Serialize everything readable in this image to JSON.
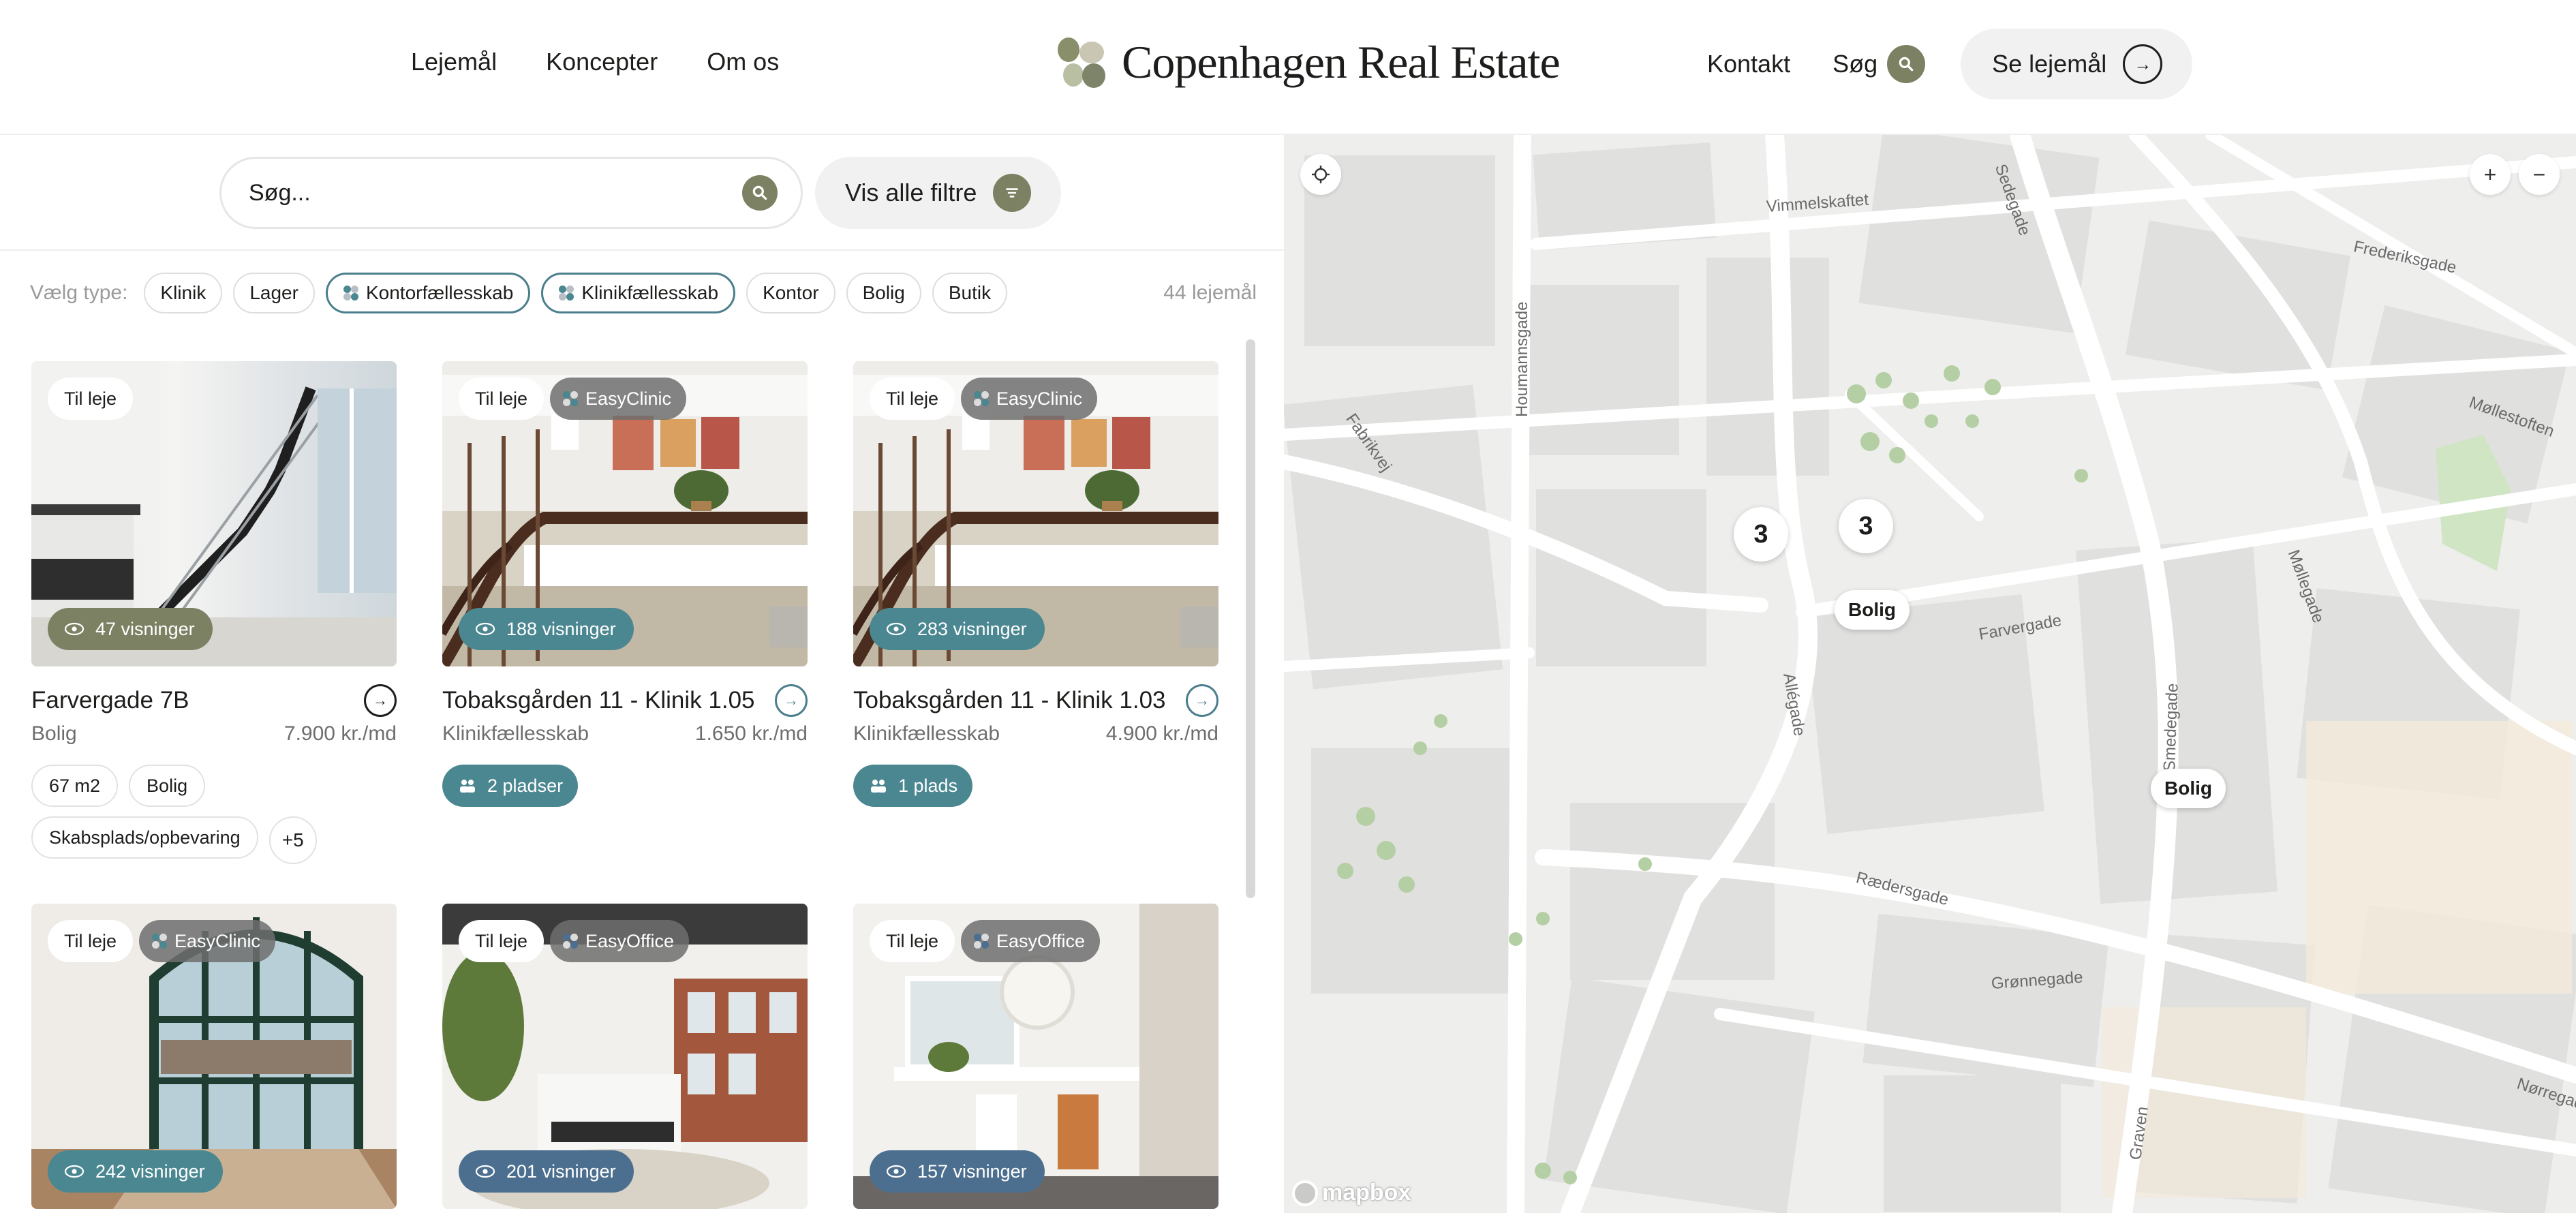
{
  "header": {
    "nav_left": [
      "Lejemål",
      "Koncepter",
      "Om os"
    ],
    "logo_text": "Copenhagen Real Estate",
    "contact": "Kontakt",
    "search": "Søg",
    "cta": "Se lejemål"
  },
  "search": {
    "placeholder": "Søg...",
    "filters_label": "Vis alle filtre"
  },
  "types": {
    "label": "Vælg type:",
    "chips": [
      "Klinik",
      "Lager",
      "Kontorfællesskab",
      "Klinikfællesskab",
      "Kontor",
      "Bolig",
      "Butik"
    ],
    "count": "44 lejemål"
  },
  "listings": [
    {
      "status": "Til leje",
      "brand": "",
      "views": "47 visninger",
      "title": "Farvergade 7B",
      "type": "Bolig",
      "price": "7.900 kr./md",
      "tags": [
        "67 m2",
        "Bolig",
        "Skabsplads/opbevaring",
        "+5"
      ],
      "seats": ""
    },
    {
      "status": "Til leje",
      "brand": "EasyClinic",
      "views": "188 visninger",
      "title": "Tobaksgården 11 - Klinik 1.05",
      "type": "Klinikfællesskab",
      "price": "1.650 kr./md",
      "tags": [],
      "seats": "2 pladser"
    },
    {
      "status": "Til leje",
      "brand": "EasyClinic",
      "views": "283 visninger",
      "title": "Tobaksgården 11 - Klinik 1.03",
      "type": "Klinikfællesskab",
      "price": "4.900 kr./md",
      "tags": [],
      "seats": "1 plads"
    },
    {
      "status": "Til leje",
      "brand": "EasyClinic",
      "views": "242 visninger"
    },
    {
      "status": "Til leje",
      "brand": "EasyOffice",
      "views": "201 visninger"
    },
    {
      "status": "Til leje",
      "brand": "EasyOffice",
      "views": "157 visninger"
    }
  ],
  "map": {
    "clusters": [
      "3",
      "3"
    ],
    "markers": [
      "Bolig",
      "Bolig"
    ],
    "streets": [
      "Vimmelskaftet",
      "Frederiksgade",
      "Houmannsgade",
      "Fabrikvej",
      "Møllestoften",
      "Møllegade",
      "Farvergade",
      "Allégade",
      "Smedegade",
      "Rædersgade",
      "Grønnegade",
      "Graven",
      "Nørregade",
      "Sedegade"
    ],
    "attribution": "mapbox",
    "zoom_in": "+",
    "zoom_out": "−"
  },
  "colors": {
    "olive": "#7c8163",
    "teal": "#4b8791",
    "chip_outline": "#4b7f8c"
  }
}
